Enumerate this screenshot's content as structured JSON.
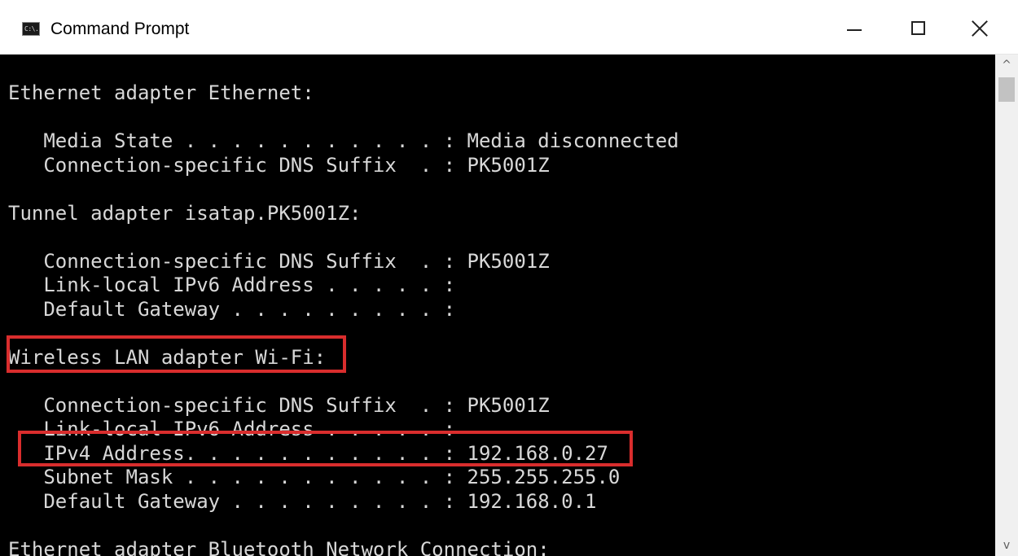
{
  "window": {
    "title": "Command Prompt",
    "icon": "cmd-icon",
    "icon_text": "C:\\."
  },
  "controls": {
    "minimize": "minimize-icon",
    "maximize": "maximize-icon",
    "close": "close-icon"
  },
  "console": {
    "background": "#000000",
    "foreground": "#d8d8d8",
    "lines": [
      "Ethernet adapter Ethernet:",
      "",
      "   Media State . . . . . . . . . . . : Media disconnected",
      "   Connection-specific DNS Suffix  . : PK5001Z",
      "",
      "Tunnel adapter isatap.PK5001Z:",
      "",
      "   Connection-specific DNS Suffix  . : PK5001Z",
      "   Link-local IPv6 Address . . . . . :",
      "   Default Gateway . . . . . . . . . :",
      "",
      "Wireless LAN adapter Wi-Fi:",
      "",
      "   Connection-specific DNS Suffix  . : PK5001Z",
      "   Link-local IPv6 Address . . . . . :",
      "   IPv4 Address. . . . . . . . . . . : 192.168.0.27",
      "   Subnet Mask . . . . . . . . . . . : 255.255.255.0",
      "   Default Gateway . . . . . . . . . : 192.168.0.1",
      "",
      "Ethernet adapter Bluetooth Network Connection:"
    ]
  },
  "highlights": {
    "color": "#d92d2d",
    "wifi_adapter": "Wireless LAN adapter Wi-Fi:",
    "ipv4_line": "IPv4 Address. . . . . . . . . . . : 192.168.0.27"
  },
  "scrollbar": {
    "up_arrow": "^",
    "down_arrow": "v"
  }
}
